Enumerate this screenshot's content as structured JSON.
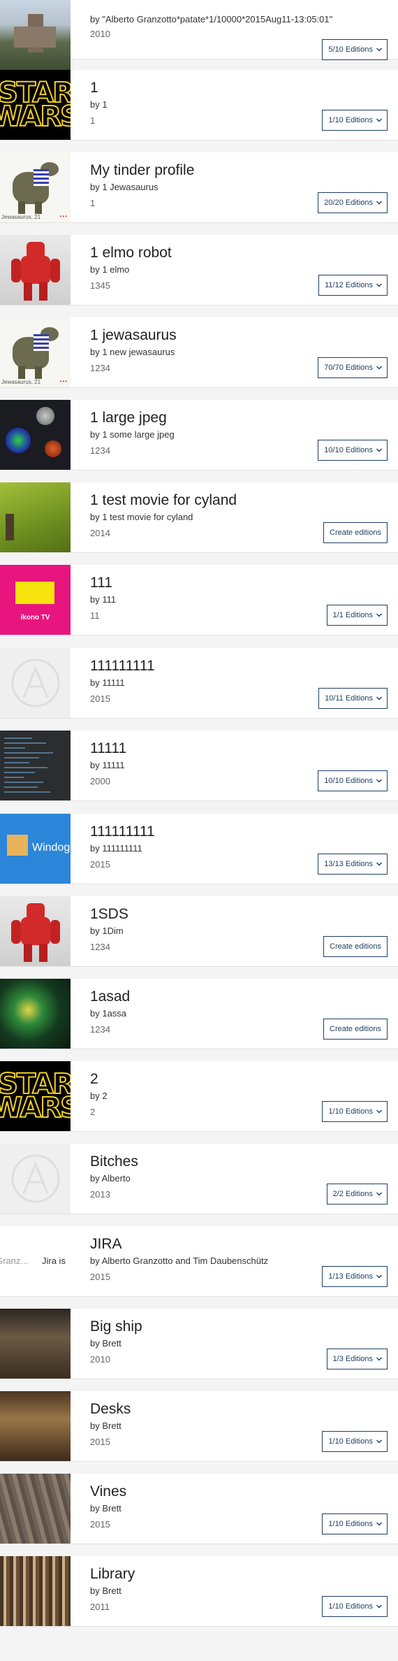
{
  "items": [
    {
      "title": "",
      "artist": "by \"Alberto Granzotto*patate*1/10000*2015Aug11-13:05:01\"",
      "year": "2010",
      "button": "5/10 Editions",
      "thumb": "church"
    },
    {
      "title": "1",
      "artist": "by 1",
      "year": "1",
      "button": "1/10 Editions",
      "thumb": "starwars"
    },
    {
      "title": "My tinder profile",
      "artist": "by 1 Jewasaurus",
      "year": "1",
      "button": "20/20 Editions",
      "thumb": "dino"
    },
    {
      "title": "1 elmo robot",
      "artist": "by 1 elmo",
      "year": "1345",
      "button": "11/12 Editions",
      "thumb": "robot"
    },
    {
      "title": "1 jewasaurus",
      "artist": "by 1 new jewasaurus",
      "year": "1234",
      "button": "70/70 Editions",
      "thumb": "dino"
    },
    {
      "title": "1 large jpeg",
      "artist": "by 1 some large jpeg",
      "year": "1234",
      "button": "10/10 Editions",
      "thumb": "jpeg"
    },
    {
      "title": "1 test movie for cyland",
      "artist": "by 1 test movie for cyland",
      "year": "2014",
      "button": "Create editions",
      "thumb": "grass"
    },
    {
      "title": "111",
      "artist": "by 111",
      "year": "11",
      "button": "1/1 Editions",
      "thumb": "ikono"
    },
    {
      "title": "111111111",
      "artist": "by 11111",
      "year": "2015",
      "button": "10/11 Editions",
      "thumb": "placeholder"
    },
    {
      "title": "11111",
      "artist": "by 11111",
      "year": "2000",
      "button": "10/10 Editions",
      "thumb": "code"
    },
    {
      "title": "111111111",
      "artist": "by 111111111",
      "year": "2015",
      "button": "13/13 Editions",
      "thumb": "windoge"
    },
    {
      "title": "1SDS",
      "artist": "by 1Dim",
      "year": "1234",
      "button": "Create editions",
      "thumb": "robot"
    },
    {
      "title": "1asad",
      "artist": "by 1assa",
      "year": "1234",
      "button": "Create editions",
      "thumb": "nebula"
    },
    {
      "title": "2",
      "artist": "by 2",
      "year": "2",
      "button": "1/10 Editions",
      "thumb": "starwars"
    },
    {
      "title": "Bitches",
      "artist": "by Alberto",
      "year": "2013",
      "button": "2/2 Editions",
      "thumb": "placeholder"
    },
    {
      "title": "JIRA",
      "artist": "by Alberto Granzotto and Tim Daubenschütz",
      "year": "2015",
      "button": "1/13 Editions",
      "thumb": "jira"
    },
    {
      "title": "Big ship",
      "artist": "by Brett",
      "year": "2010",
      "button": "1/3 Editions",
      "thumb": "ship"
    },
    {
      "title": "Desks",
      "artist": "by Brett",
      "year": "2015",
      "button": "1/10 Editions",
      "thumb": "desks"
    },
    {
      "title": "Vines",
      "artist": "by Brett",
      "year": "2015",
      "button": "1/10 Editions",
      "thumb": "vines"
    },
    {
      "title": "Library",
      "artist": "by Brett",
      "year": "2011",
      "button": "1/10 Editions",
      "thumb": "library"
    }
  ],
  "thumb_text": {
    "starwars_line1": "STAR",
    "starwars_line2": "WARS",
    "dino_caption": "Jewasaurus, 21",
    "dino_dots": "•••",
    "ikono_label": "ikono TV",
    "windoge_label": "Windoge",
    "jira_left": "Granz...",
    "jira_right": "Jira is"
  },
  "colors": {
    "button_border": "#1f3f63",
    "card_bg": "#ffffff",
    "page_bg": "#f4f4f4"
  },
  "icons": {
    "chevron": "chevron-down-icon"
  }
}
